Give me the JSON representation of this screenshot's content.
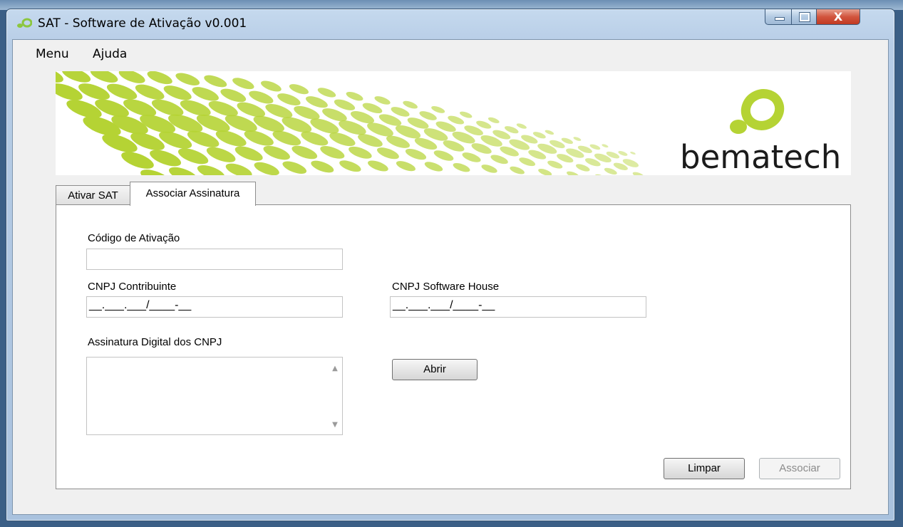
{
  "window": {
    "title": "SAT - Software de Ativação v0.001",
    "close_glyph": "X"
  },
  "menu": {
    "items": [
      "Menu",
      "Ajuda"
    ]
  },
  "banner": {
    "brand": "bematech",
    "logo_icon": "bematech-logo-icon",
    "accent": "#b5d334"
  },
  "tabs": [
    {
      "label": "Ativar SAT",
      "active": false
    },
    {
      "label": "Associar Assinatura",
      "active": true
    }
  ],
  "form": {
    "codigo_label": "Código de Ativação",
    "codigo_value": "",
    "cnpj_contribuinte_label": "CNPJ Contribuinte",
    "cnpj_contribuinte_value": "__.___.___/____-__",
    "cnpj_software_label": "CNPJ Software House",
    "cnpj_software_value": "__.___.___/____-__",
    "assinatura_label": "Assinatura Digital dos CNPJ",
    "abrir_label": "Abrir",
    "limpar_label": "Limpar",
    "associar_label": "Associar"
  }
}
